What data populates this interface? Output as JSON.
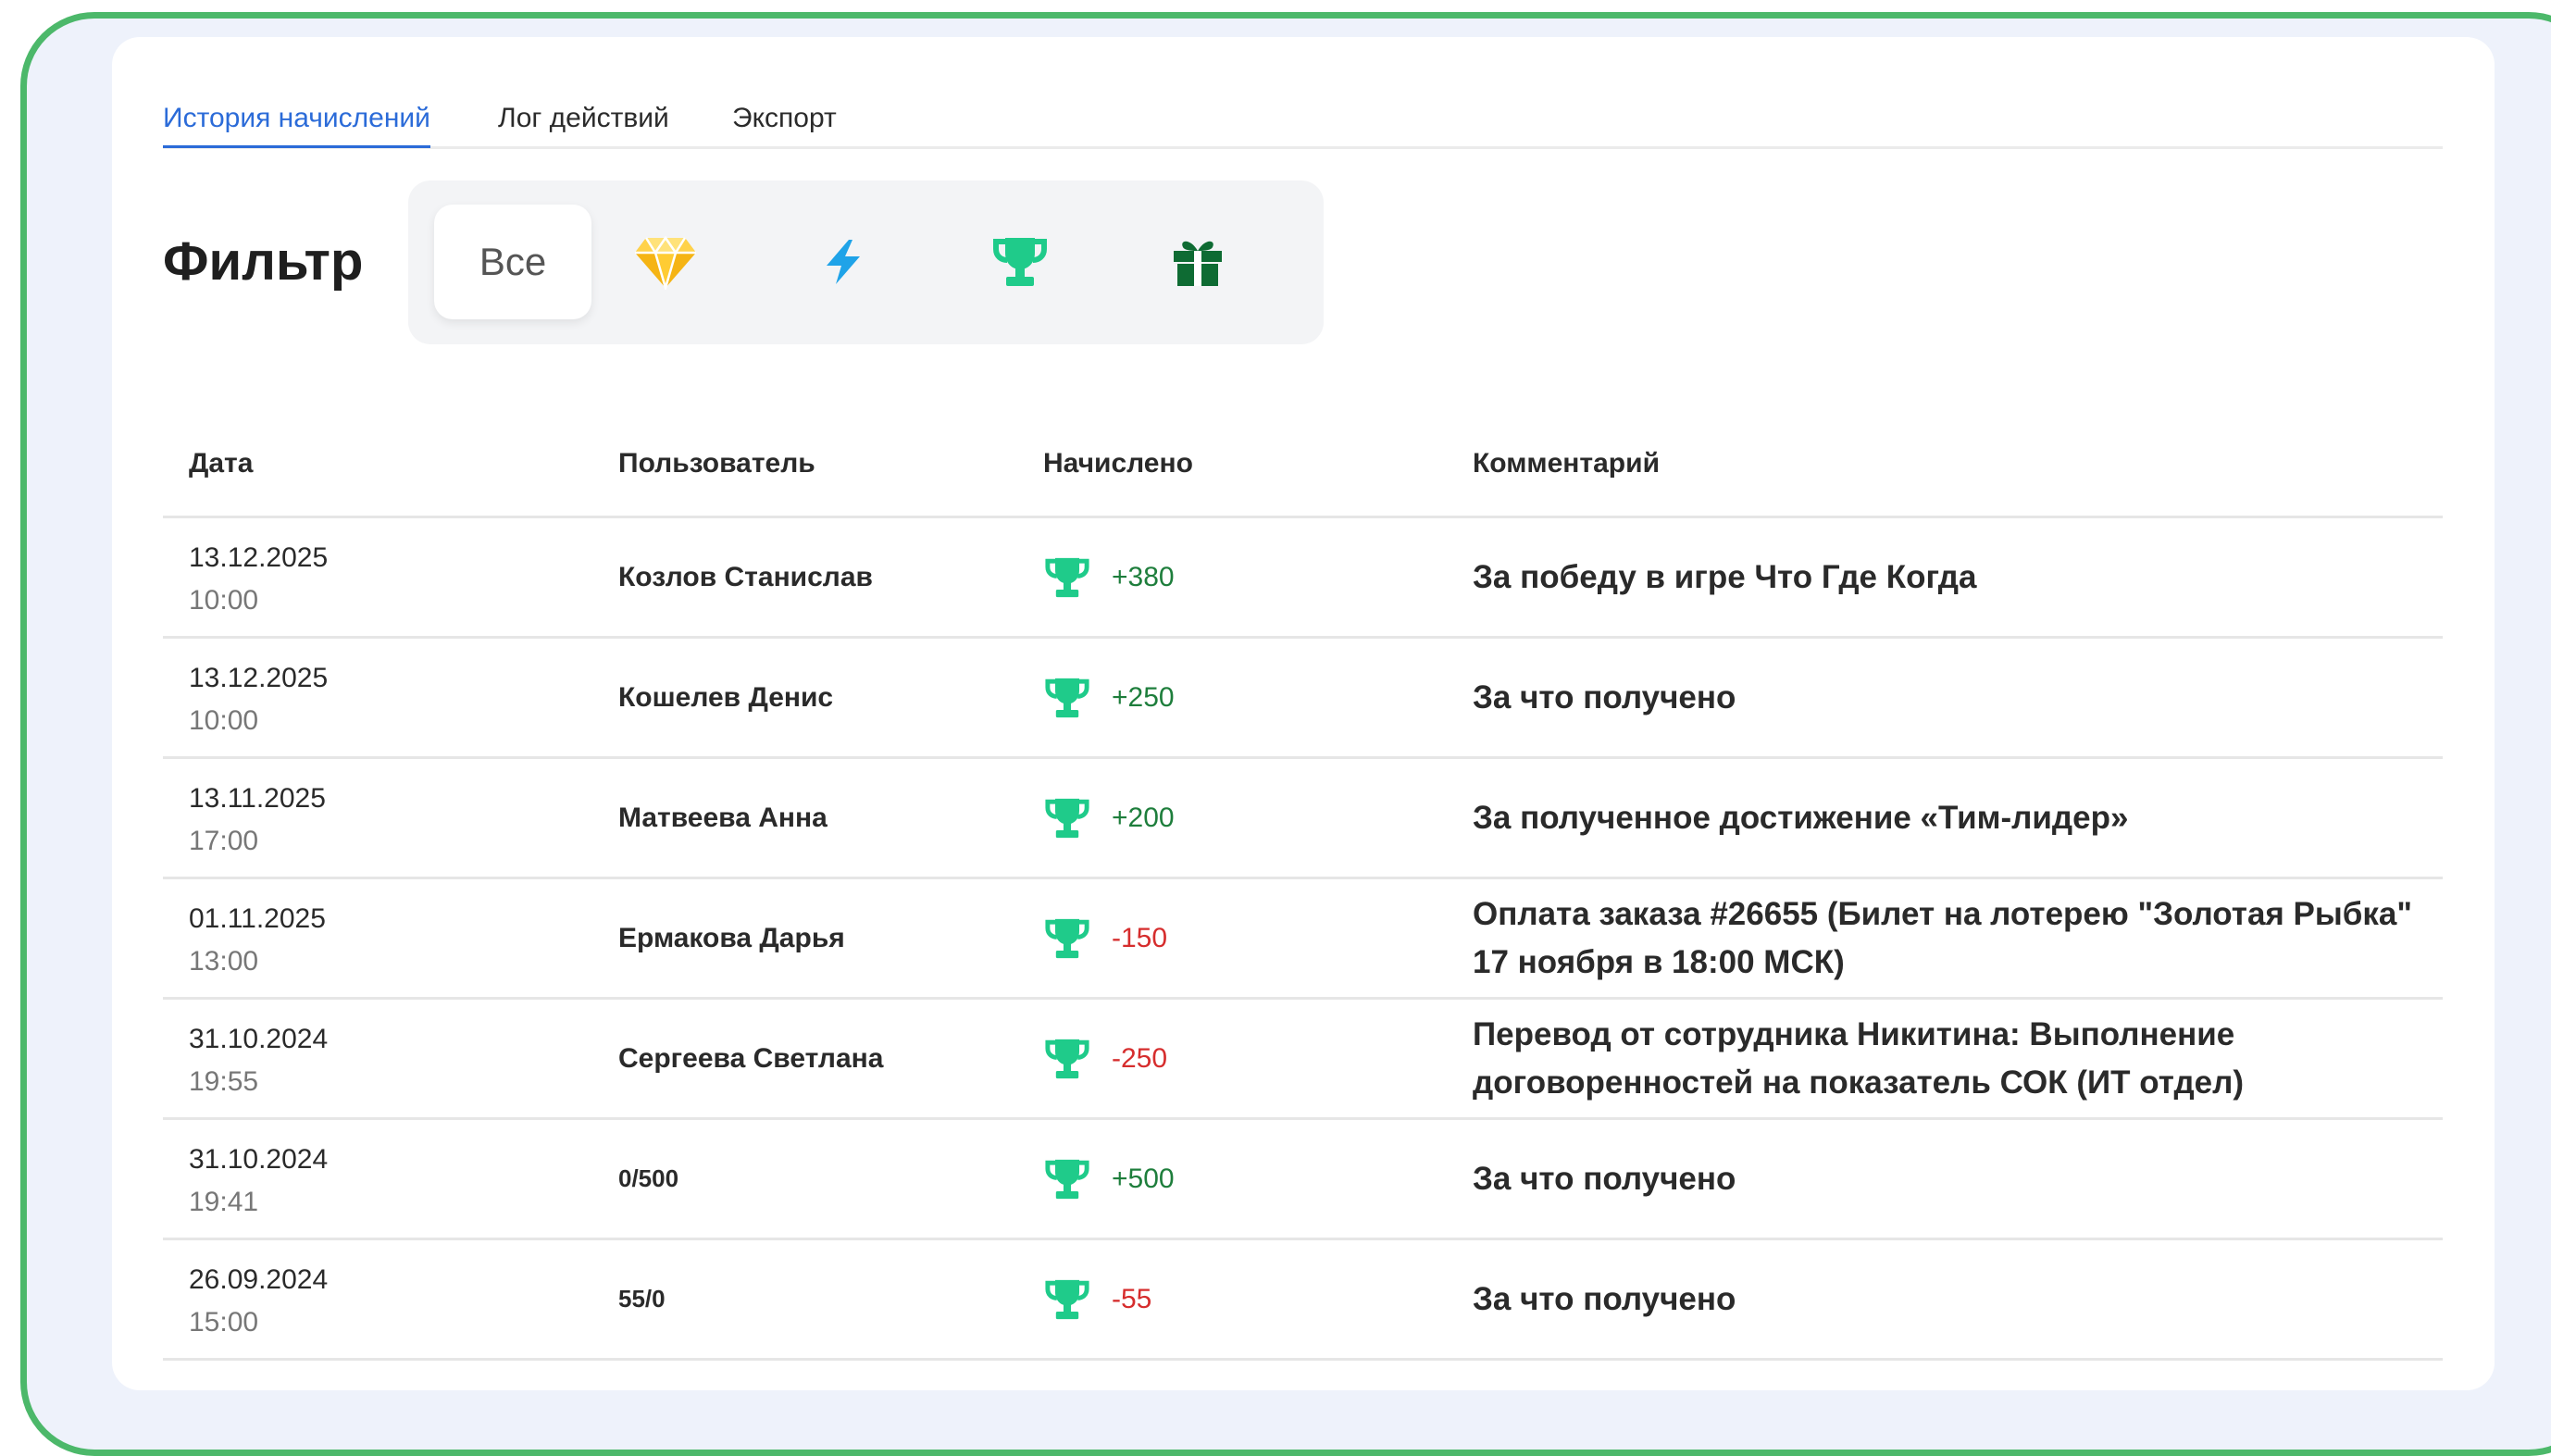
{
  "tabs": [
    {
      "label": "История начислений",
      "active": true
    },
    {
      "label": "Лог действий",
      "active": false
    },
    {
      "label": "Экспорт",
      "active": false
    }
  ],
  "filter": {
    "label": "Фильтр",
    "all_label": "Все",
    "icons": [
      "diamond-icon",
      "lightning-icon",
      "trophy-icon",
      "gift-icon"
    ]
  },
  "table": {
    "headers": {
      "date": "Дата",
      "user": "Пользователь",
      "amount": "Начислено",
      "comment": "Комментарий"
    },
    "rows": [
      {
        "date": "13.12.2025",
        "time": "10:00",
        "user": "Козлов Станислав",
        "amount": "+380",
        "comment": "За победу в игре Что Где Когда"
      },
      {
        "date": "13.12.2025",
        "time": "10:00",
        "user": "Кошелев Денис",
        "amount": "+250",
        "comment": "За что получено"
      },
      {
        "date": "13.11.2025",
        "time": "17:00",
        "user": "Матвеева Анна",
        "amount": "+200",
        "comment": "За полученное достижение «Тим-лидер»"
      },
      {
        "date": "01.11.2025",
        "time": "13:00",
        "user": "Ермакова Дарья",
        "amount": "-150",
        "comment": "Оплата заказа #26655 (Билет на лотерею \"Золотая Рыбка\" 17 ноября в 18:00 МСК)"
      },
      {
        "date": "31.10.2024",
        "time": "19:55",
        "user": "Сергеева Светлана",
        "amount": "-250",
        "comment": "Перевод от сотрудника Никитина: Выполнение договоренностей на показатель СОК (ИТ отдел)"
      },
      {
        "date": "31.10.2024",
        "time": "19:41",
        "user": "0/500",
        "amount": "+500",
        "comment": "За что получено"
      },
      {
        "date": "26.09.2024",
        "time": "15:00",
        "user": "55/0",
        "amount": "-55",
        "comment": "За что получено"
      }
    ]
  },
  "colors": {
    "accent": "#2b6bd8",
    "frame_border": "#4cb86a",
    "positive": "#1e7e3c",
    "negative": "#d62d2d",
    "trophy": "#1fcb8a"
  }
}
